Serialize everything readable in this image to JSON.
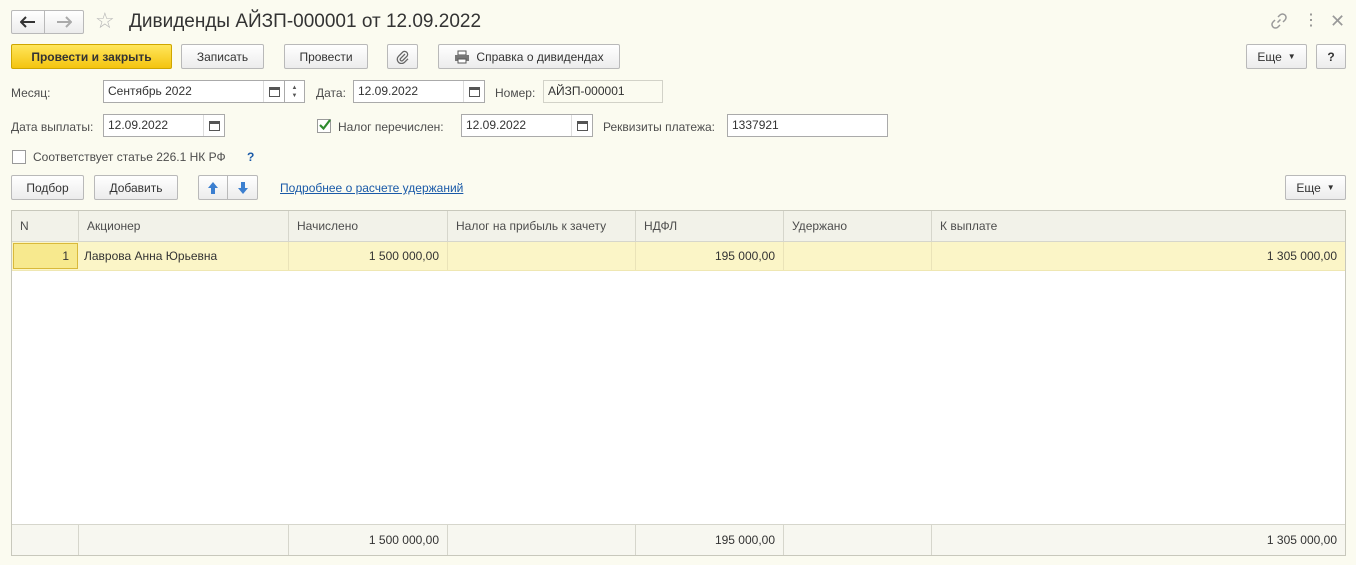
{
  "window": {
    "title": "Дивиденды АЙЗП-000001 от 12.09.2022",
    "back_icon": "arrow-left-icon",
    "forward_icon": "arrow-right-icon",
    "favorite_icon": "star-icon",
    "link_icon": "link-icon",
    "menu_icon": "kebab-menu-icon",
    "close_icon": "close-icon"
  },
  "toolbar": {
    "post_and_close": "Провести и закрыть",
    "save": "Записать",
    "post": "Провести",
    "attach_icon": "paperclip-icon",
    "print_icon": "printer-icon",
    "dividend_report": "Справка о дивидендах",
    "more": "Еще",
    "help": "?"
  },
  "form": {
    "month_label": "Месяц:",
    "month_value": "Сентябрь 2022",
    "date_label": "Дата:",
    "date_value": "12.09.2022",
    "number_label": "Номер:",
    "number_value": "АЙЗП-000001",
    "payment_date_label": "Дата выплаты:",
    "payment_date_value": "12.09.2022",
    "tax_transferred_label": "Налог перечислен:",
    "tax_transferred_checked": true,
    "tax_transferred_date": "12.09.2022",
    "payment_details_label": "Реквизиты платежа:",
    "payment_details_value": "1337921",
    "article_label": "Соответствует статье 226.1 НК РФ",
    "article_checked": false,
    "article_help": "?"
  },
  "table_toolbar": {
    "select": "Подбор",
    "add": "Добавить",
    "move_up_icon": "arrow-up-icon",
    "move_down_icon": "arrow-down-icon",
    "details_link": "Подробнее о расчете удержаний",
    "more": "Еще"
  },
  "table": {
    "columns": [
      "N",
      "Акционер",
      "Начислено",
      "Налог на прибыль к зачету",
      "НДФЛ",
      "Удержано",
      "К выплате"
    ],
    "rows": [
      [
        "1",
        "Лаврова Анна Юрьевна",
        "1 500 000,00",
        "",
        "195 000,00",
        "",
        "1 305 000,00"
      ]
    ],
    "totals": [
      "",
      "",
      "1 500 000,00",
      "",
      "195 000,00",
      "",
      "1 305 000,00"
    ]
  },
  "colors": {
    "background": "#fbfbf0",
    "primary_button": "#f4c40f",
    "selected_row": "#fbf5c7",
    "link": "#1a5aa8",
    "check": "#2e8b2e"
  }
}
